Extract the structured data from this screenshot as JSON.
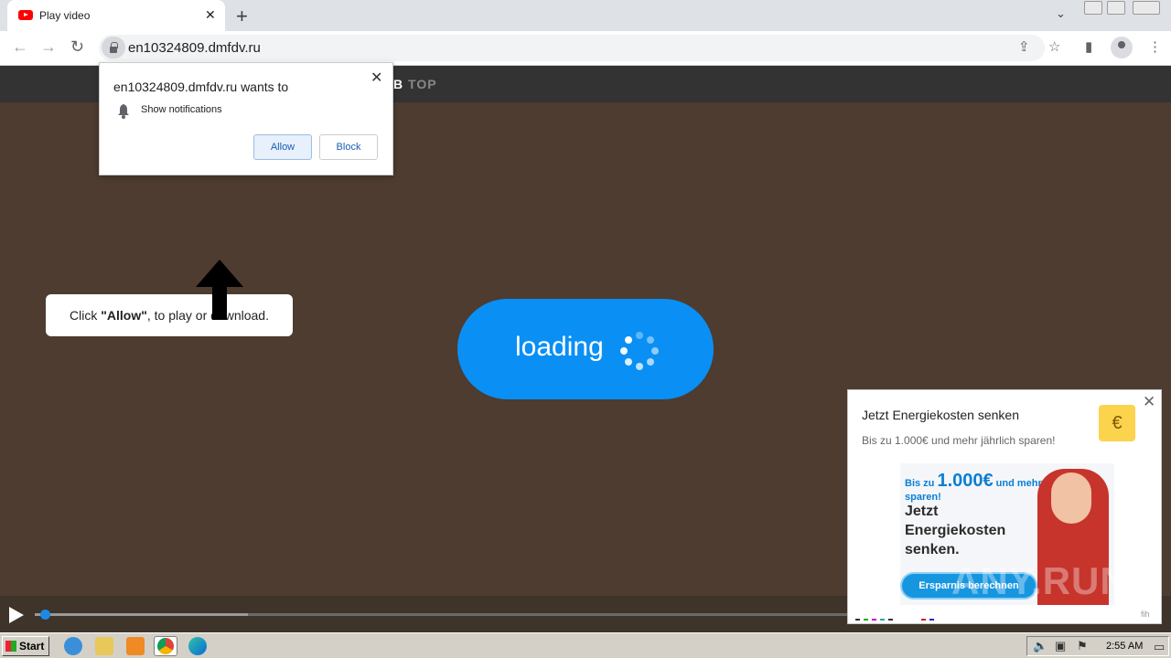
{
  "browser": {
    "tab_title": "Play video",
    "url": "en10324809.dmfdv.ru",
    "icons": [
      "back-icon",
      "forward-icon",
      "reload-icon",
      "lock-icon",
      "share-icon",
      "star-icon",
      "sidepanel-icon",
      "profile-icon",
      "menu-icon"
    ]
  },
  "page": {
    "logo_bold": "B",
    "logo_rest": "TOP",
    "hint_prefix": "Click ",
    "hint_bold": "\"Allow\"",
    "hint_suffix": ", to play or download.",
    "loading_text": "loading",
    "accent_color": "#0a8ff5"
  },
  "permission": {
    "header": "en10324809.dmfdv.ru wants to",
    "permission_label": "Show notifications",
    "allow_label": "Allow",
    "block_label": "Block"
  },
  "ad": {
    "headline": "Jetzt Energiekosten senken",
    "subline": "Bis zu 1.000€ und mehr jährlich sparen!",
    "creative_line1_prefix": "Bis zu ",
    "creative_amount": "1.000€",
    "creative_line1_suffix": " und mehr jährlich sparen!",
    "creative_big_1": "Jetzt",
    "creative_big_2": "Energiekosten",
    "creative_big_3": "senken.",
    "creative_button": "Ersparnis berechnen",
    "adchoice": "fih"
  },
  "watermark": "ANY.RUN",
  "taskbar": {
    "start_label": "Start",
    "clock": "2:55 AM"
  }
}
